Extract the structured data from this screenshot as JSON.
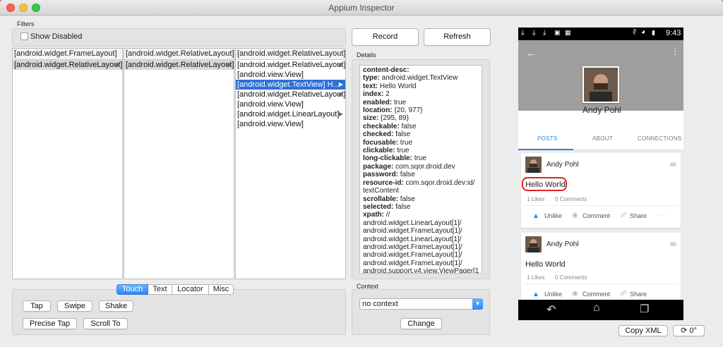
{
  "window": {
    "title": "Appium Inspector"
  },
  "filters": {
    "label": "Filters",
    "show_disabled_label": "Show Disabled"
  },
  "toolbar": {
    "record_label": "Record",
    "refresh_label": "Refresh"
  },
  "hierarchy": {
    "columns": [
      {
        "header": "[android.widget.FrameLayout]",
        "items": [
          {
            "label": "[android.widget.RelativeLayout]",
            "expandable": true,
            "selected": "grey"
          }
        ]
      },
      {
        "header": "[android.widget.RelativeLayout]",
        "items": [
          {
            "label": "[android.widget.RelativeLayout]",
            "expandable": true,
            "selected": "grey"
          }
        ]
      },
      {
        "header": "[android.widget.RelativeLayout]",
        "items": [
          {
            "label": "[android.widget.RelativeLayout]",
            "expandable": true,
            "selected": ""
          },
          {
            "label": "[android.view.View]",
            "expandable": false,
            "selected": ""
          },
          {
            "label": "[android.widget.TextView] H...",
            "expandable": true,
            "selected": "blue"
          },
          {
            "label": "[android.widget.RelativeLayout]",
            "expandable": true,
            "selected": ""
          },
          {
            "label": "[android.view.View]",
            "expandable": false,
            "selected": ""
          },
          {
            "label": "[android.widget.LinearLayout]",
            "expandable": true,
            "selected": ""
          },
          {
            "label": "[android.view.View]",
            "expandable": false,
            "selected": ""
          }
        ]
      }
    ]
  },
  "details": {
    "label": "Details",
    "rows": [
      {
        "key": "content-desc:",
        "value": ""
      },
      {
        "key": "type:",
        "value": " android.widget.TextView"
      },
      {
        "key": "text:",
        "value": " Hello World"
      },
      {
        "key": "index:",
        "value": " 2"
      },
      {
        "key": "enabled:",
        "value": " true"
      },
      {
        "key": "location:",
        "value": " {20, 977}"
      },
      {
        "key": "size:",
        "value": " {295, 89}"
      },
      {
        "key": "checkable:",
        "value": " false"
      },
      {
        "key": "checked:",
        "value": " false"
      },
      {
        "key": "focusable:",
        "value": " true"
      },
      {
        "key": "clickable:",
        "value": " true"
      },
      {
        "key": "long-clickable:",
        "value": " true"
      },
      {
        "key": "package:",
        "value": " com.sqor.droid.dev"
      },
      {
        "key": "password:",
        "value": " false"
      },
      {
        "key": "resource-id:",
        "value": " com.sqor.droid.dev:id/"
      },
      {
        "key": "",
        "value": "textContent"
      },
      {
        "key": "scrollable:",
        "value": " false"
      },
      {
        "key": "selected:",
        "value": " false"
      },
      {
        "key": "xpath:",
        "value": " //"
      },
      {
        "key": "",
        "value": "android.widget.LinearLayout[1]/"
      },
      {
        "key": "",
        "value": "android.widget.FrameLayout[1]/"
      },
      {
        "key": "",
        "value": "android.widget.LinearLayout[1]/"
      },
      {
        "key": "",
        "value": "android.widget.FrameLayout[1]/"
      },
      {
        "key": "",
        "value": "android.widget.FrameLayout[1]/"
      },
      {
        "key": "",
        "value": "android.widget.FrameLayout[1]/"
      },
      {
        "key": "",
        "value": "android.support.v4.view.ViewPager[1"
      }
    ]
  },
  "actions": {
    "tabs": [
      {
        "label": "Touch",
        "active": true
      },
      {
        "label": "Text",
        "active": false
      },
      {
        "label": "Locator",
        "active": false
      },
      {
        "label": "Misc",
        "active": false
      }
    ],
    "tap_label": "Tap",
    "swipe_label": "Swipe",
    "shake_label": "Shake",
    "precise_tap_label": "Precise Tap",
    "scroll_to_label": "Scroll To"
  },
  "context": {
    "label": "Context",
    "selected": "no context",
    "change_label": "Change"
  },
  "device": {
    "status_time": "9:43",
    "profile_name": "Andy Pohl",
    "tabs": [
      "POSTS",
      "ABOUT",
      "CONNECTIONS"
    ],
    "posts": [
      {
        "author": "Andy Pohl",
        "time": "4h",
        "text": "Hello World",
        "likes": "1 Likes",
        "comments": "0 Comments",
        "actions": [
          "Unlike",
          "Comment",
          "Share"
        ],
        "highlighted": true
      },
      {
        "author": "Andy Pohl",
        "time": "4h",
        "text": "Hello World",
        "likes": "1 Likes",
        "comments": "0 Comments",
        "actions": [
          "Unlike",
          "Comment",
          "Share"
        ],
        "highlighted": false
      }
    ],
    "highlight_color": "#e0221f",
    "accent_color": "#2b87d6"
  },
  "bottom": {
    "copy_xml_label": "Copy XML",
    "rotation_label": "0°"
  }
}
